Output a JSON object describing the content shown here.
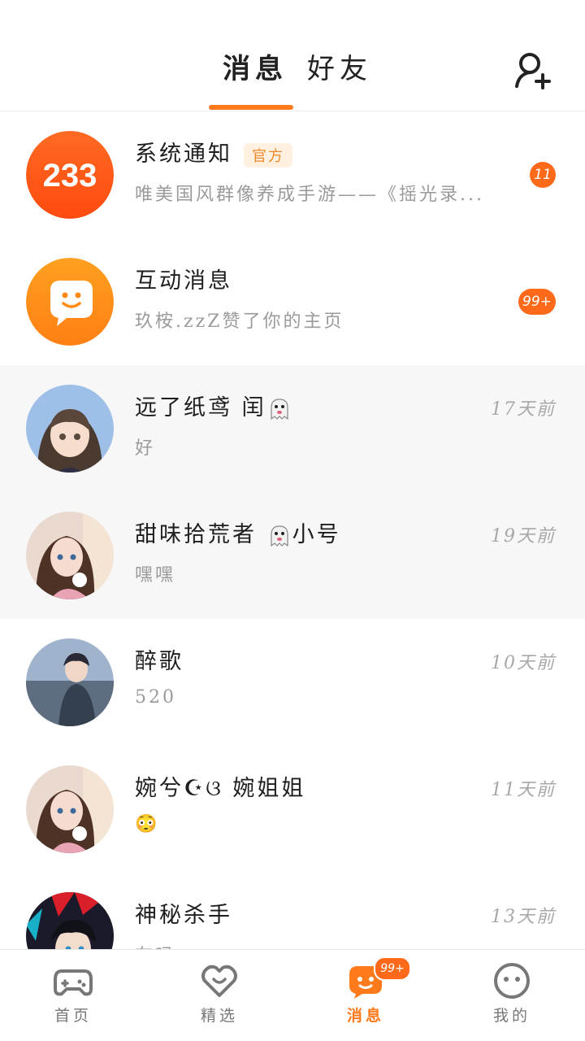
{
  "header": {
    "tabs": [
      {
        "label": "消息",
        "active": true
      },
      {
        "label": "好友",
        "active": false
      }
    ],
    "add_friend_icon": "add-user-icon"
  },
  "conversations": [
    {
      "name": "系统通知",
      "tag": "官方",
      "preview": "唯美国风群像养成手游——《摇光录...",
      "badge": "11",
      "avatar": "233-logo",
      "avatar_text": "233"
    },
    {
      "name": "互动消息",
      "preview": "玖桉.zzZ赞了你的主页",
      "badge": "99+",
      "avatar": "chat-bubble-face-icon"
    },
    {
      "name_pre": "远了纸鸢  闰",
      "name_post": "",
      "preview": "好",
      "time": "17天前",
      "avatar": "anime-girl-avatar",
      "emoji": "ghost-emoji"
    },
    {
      "name_pre": "甜味拾荒者  ",
      "name_post": "小号",
      "preview": "嘿嘿",
      "time": "19天前",
      "avatar": "anime-girl-cat-avatar",
      "emoji": "ghost-emoji"
    },
    {
      "name": "醉歌",
      "preview": "520",
      "time": "10天前",
      "avatar": "anime-boy-avatar"
    },
    {
      "name": "婉兮☪ଓ  婉姐姐",
      "preview": "😳",
      "time": "11天前",
      "avatar": "anime-girl-cat-avatar"
    },
    {
      "name": "神秘杀手",
      "preview": "在吗",
      "time": "13天前",
      "avatar": "anime-red-hair-avatar"
    }
  ],
  "bottom_nav": [
    {
      "label": "首页",
      "icon": "gamepad-icon",
      "active": false
    },
    {
      "label": "精选",
      "icon": "heart-icon",
      "active": false
    },
    {
      "label": "消息",
      "icon": "message-icon",
      "active": true,
      "badge": "99+"
    },
    {
      "label": "我的",
      "icon": "face-icon",
      "active": false
    }
  ],
  "colors": {
    "accent": "#ff7a1a",
    "badge": "#ff6a1a",
    "tag_bg": "#fff0e0"
  }
}
